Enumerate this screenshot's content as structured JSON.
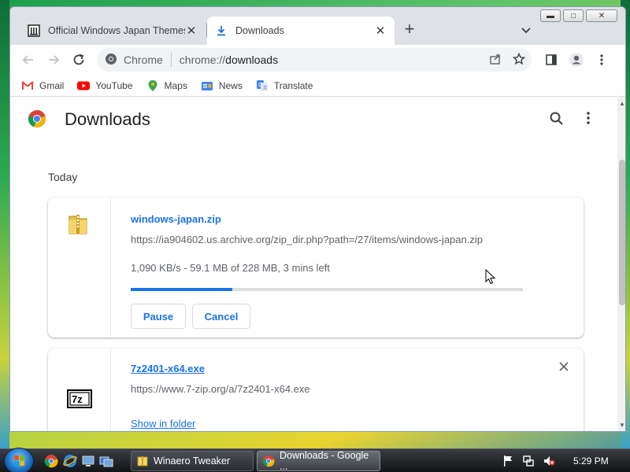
{
  "window": {
    "controls": [
      "minimize",
      "maximize",
      "close"
    ]
  },
  "tabs": [
    {
      "title": "Official Windows Japan Themes a",
      "icon": "museum-icon",
      "active": false
    },
    {
      "title": "Downloads",
      "icon": "download-icon",
      "active": true
    }
  ],
  "toolbar": {
    "site_label": "Chrome",
    "url_scheme": "chrome://",
    "url_path": "downloads"
  },
  "bookmarks": [
    {
      "label": "Gmail",
      "icon": "gmail-icon"
    },
    {
      "label": "YouTube",
      "icon": "youtube-icon"
    },
    {
      "label": "Maps",
      "icon": "maps-icon"
    },
    {
      "label": "News",
      "icon": "news-icon"
    },
    {
      "label": "Translate",
      "icon": "translate-icon"
    }
  ],
  "page": {
    "title": "Downloads",
    "section_date": "Today"
  },
  "downloads": [
    {
      "file_name": "windows-japan.zip",
      "url": "https://ia904602.us.archive.org/zip_dir.php?path=/27/items/windows-japan.zip",
      "status": "1,090 KB/s - 59.1 MB of 228 MB, 3 mins left",
      "progress_percent": 25.9,
      "pause_label": "Pause",
      "cancel_label": "Cancel",
      "icon": "zip-folder-icon"
    },
    {
      "file_name": "7z2401-x64.exe",
      "url": "https://www.7-zip.org/a/7z2401-x64.exe",
      "show_in_folder_label": "Show in folder",
      "icon": "7zip-icon"
    }
  ],
  "taskbar": {
    "items": [
      {
        "label": "Winaero Tweaker",
        "icon": "folder-icon",
        "active": false
      },
      {
        "label": "Downloads - Google ...",
        "icon": "chrome-icon",
        "active": true
      }
    ],
    "clock": "5:29 PM"
  },
  "colors": {
    "accent": "#1a73e8",
    "progress_track": "#dadce0",
    "tab_strip": "#dee1e6"
  }
}
